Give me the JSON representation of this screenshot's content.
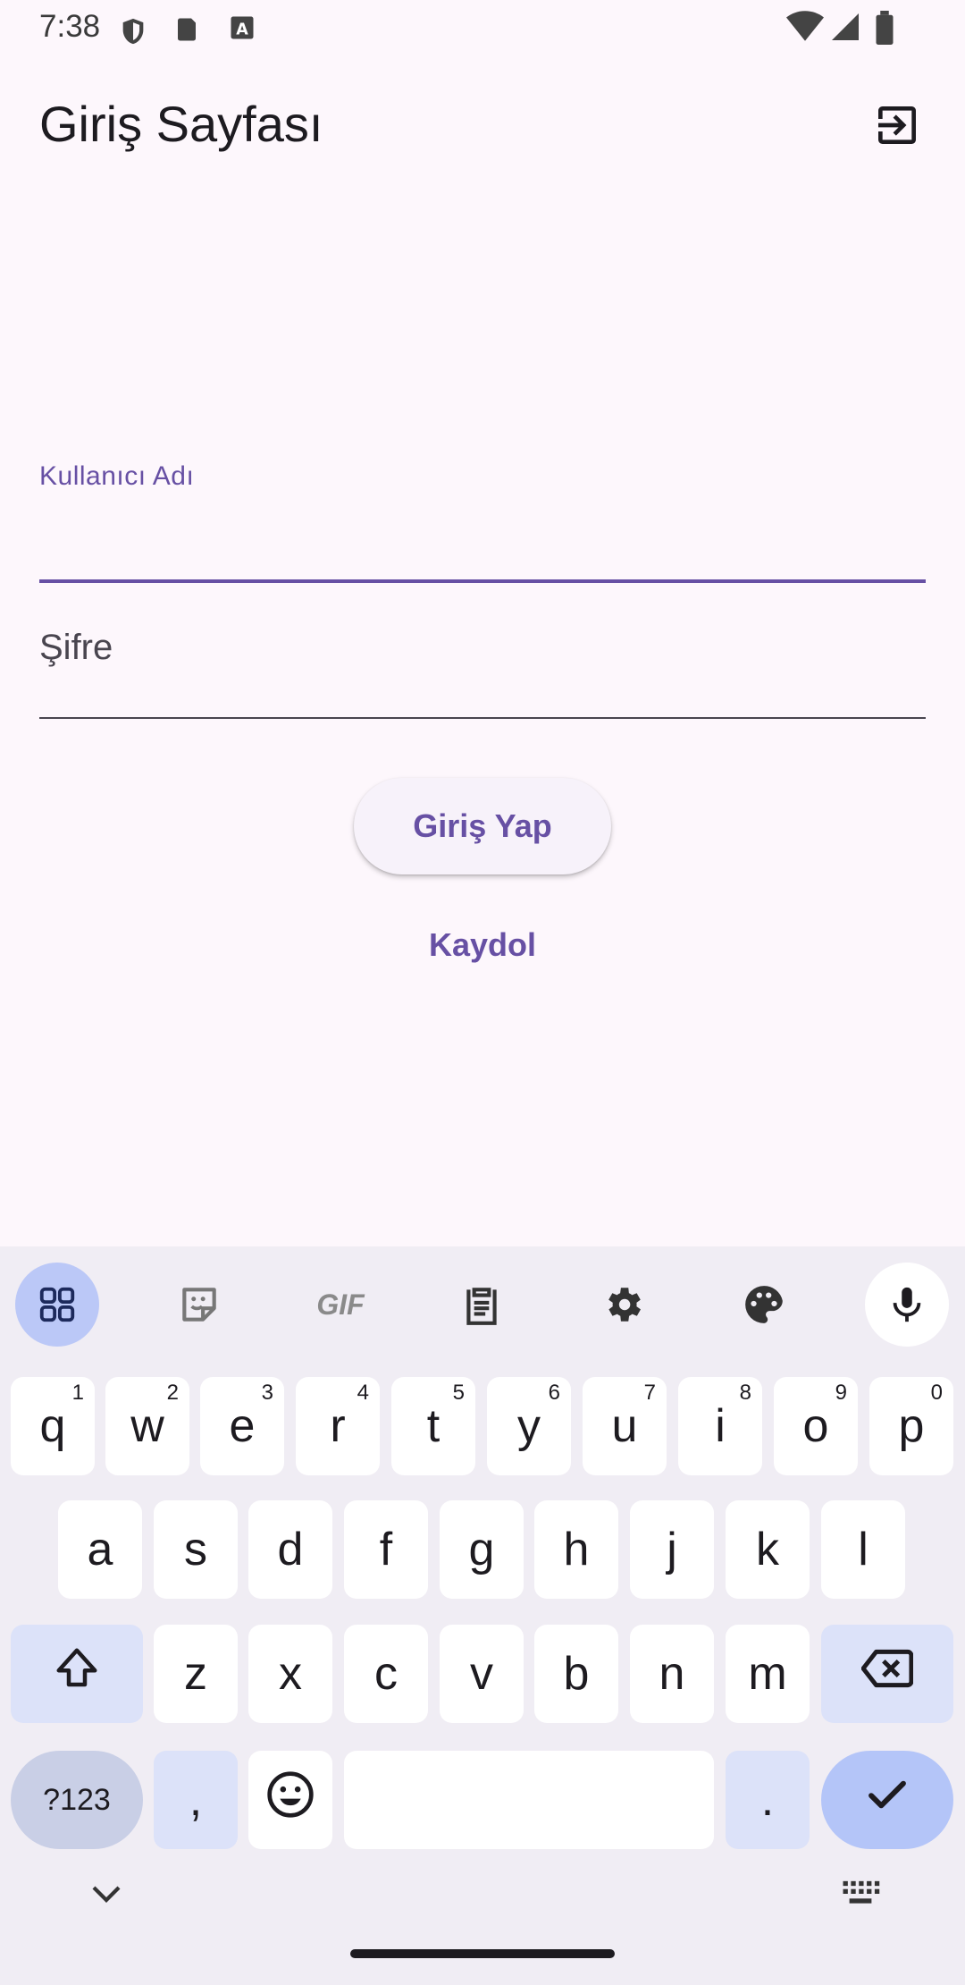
{
  "status_bar": {
    "time": "7:38",
    "left_icons": [
      "shield-icon",
      "sd-card-icon",
      "keyboard-a-icon"
    ],
    "right_icons": [
      "wifi-icon",
      "signal-icon",
      "battery-icon"
    ]
  },
  "app_bar": {
    "title": "Giriş Sayfası",
    "action_icon": "logout-icon"
  },
  "form": {
    "username_label": "Kullanıcı Adı",
    "username_value": "",
    "password_placeholder": "Şifre",
    "login_label": "Giriş Yap",
    "register_label": "Kaydol"
  },
  "keyboard": {
    "toolbar": [
      "apps-grid-icon",
      "sticker-icon",
      "gif-icon",
      "clipboard-icon",
      "settings-icon",
      "palette-icon",
      "mic-icon"
    ],
    "gif_label": "GIF",
    "row1": [
      {
        "k": "q",
        "s": "1"
      },
      {
        "k": "w",
        "s": "2"
      },
      {
        "k": "e",
        "s": "3"
      },
      {
        "k": "r",
        "s": "4"
      },
      {
        "k": "t",
        "s": "5"
      },
      {
        "k": "y",
        "s": "6"
      },
      {
        "k": "u",
        "s": "7"
      },
      {
        "k": "i",
        "s": "8"
      },
      {
        "k": "o",
        "s": "9"
      },
      {
        "k": "p",
        "s": "0"
      }
    ],
    "row2": [
      "a",
      "s",
      "d",
      "f",
      "g",
      "h",
      "j",
      "k",
      "l"
    ],
    "row3": [
      "z",
      "x",
      "c",
      "v",
      "b",
      "n",
      "m"
    ],
    "symbols_label": "?123",
    "comma_label": ",",
    "period_label": ".",
    "colors": {
      "background": "#F0EDF4",
      "key": "#FFFFFF",
      "function_key": "#DCE2F9",
      "action": "#B4C5F8",
      "accent": "#6750A4"
    }
  }
}
